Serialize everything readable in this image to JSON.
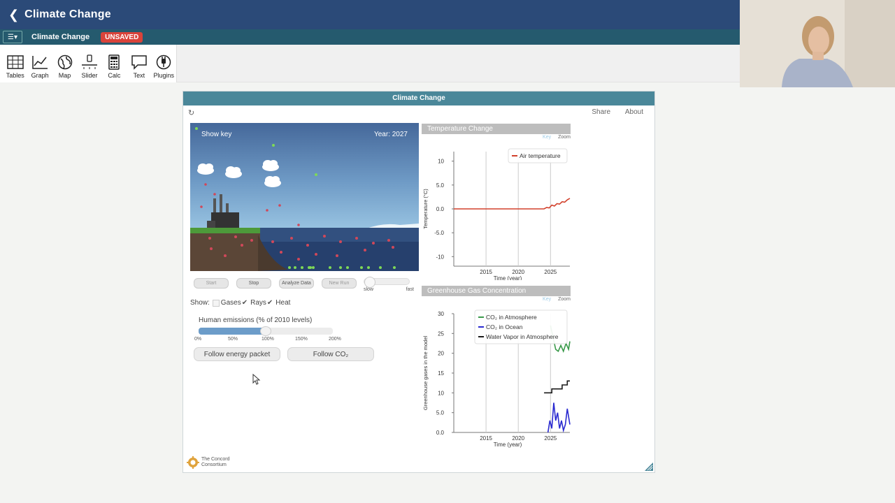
{
  "app": {
    "title": "Climate Change",
    "back_icon": "chevron-left-icon"
  },
  "docbar": {
    "doc_name": "Climate Change",
    "status": "UNSAVED"
  },
  "toolbar": {
    "tools": [
      {
        "label": "Tables",
        "icon": "table-icon"
      },
      {
        "label": "Graph",
        "icon": "graph-icon"
      },
      {
        "label": "Map",
        "icon": "globe-icon"
      },
      {
        "label": "Slider",
        "icon": "slider-icon"
      },
      {
        "label": "Calc",
        "icon": "calculator-icon"
      },
      {
        "label": "Text",
        "icon": "speech-bubble-icon"
      },
      {
        "label": "Plugins",
        "icon": "plug-icon"
      }
    ]
  },
  "tile": {
    "title": "Climate Change",
    "share": "Share",
    "about": "About"
  },
  "sim": {
    "show_key": "Show key",
    "year": "Year: 2027",
    "buttons": {
      "start": "Start",
      "stop": "Stop",
      "analyze": "Analyze Data",
      "new_run": "New Run"
    },
    "speed": {
      "slow": "slow",
      "fast": "fast",
      "level": 0
    },
    "show": {
      "label": "Show:",
      "gases": "Gases",
      "rays": "Rays",
      "heat": "Heat",
      "gases_checked": true,
      "rays_checked": true
    },
    "emissions": {
      "label": "Human emissions (% of 2010 levels)",
      "value_percent": 100,
      "ticks": [
        "0%",
        "50%",
        "100%",
        "150%",
        "200%"
      ]
    },
    "follow_energy": "Follow energy packet",
    "follow_co2": "Follow CO₂"
  },
  "chart_data": [
    {
      "type": "line",
      "title": "Temperature Change",
      "key_label": "Key",
      "zoom_label": "Zoom",
      "xlabel": "Time (year)",
      "ylabel": "Temperature (°C)",
      "xlim": [
        2010,
        2028
      ],
      "ylim": [
        -12,
        12
      ],
      "xticks": [
        "2015",
        "2020",
        "2025"
      ],
      "yticks": [
        "10",
        "5.0",
        "0.0",
        "-5.0",
        "-10"
      ],
      "legend": "top-right",
      "series": [
        {
          "name": "Air temperature",
          "color": "#d2402b",
          "x": [
            2010,
            2024.0,
            2024.4,
            2024.8,
            2025.2,
            2025.6,
            2026.0,
            2026.4,
            2026.8,
            2027.2,
            2027.6,
            2028
          ],
          "y": [
            0,
            0,
            0.3,
            0.2,
            0.8,
            0.6,
            1.1,
            1.0,
            1.5,
            1.4,
            1.9,
            2.2
          ]
        }
      ]
    },
    {
      "type": "line",
      "title": "Greenhouse Gas Concentration",
      "key_label": "Key",
      "zoom_label": "Zoom",
      "xlabel": "Time (year)",
      "ylabel": "Greenhouse gases in the model",
      "xlim": [
        2010,
        2028
      ],
      "ylim": [
        0,
        30
      ],
      "xticks": [
        "2015",
        "2020",
        "2025"
      ],
      "yticks": [
        "30",
        "25",
        "20",
        "15",
        "10",
        "5.0",
        "0.0"
      ],
      "legend": "top-right",
      "series": [
        {
          "name": "CO₂ in Atmosphere",
          "color": "#3a9a4a",
          "x": [
            2025.0,
            2025.4,
            2025.8,
            2026.2,
            2026.6,
            2027.0,
            2027.4,
            2027.8,
            2028
          ],
          "y": [
            27,
            24,
            21,
            20.5,
            22,
            20.5,
            22.5,
            21,
            23
          ]
        },
        {
          "name": "CO₂ in Ocean",
          "color": "#2a2ad0",
          "x": [
            2024.6,
            2024.9,
            2025.2,
            2025.5,
            2025.8,
            2026.1,
            2026.4,
            2026.7,
            2027.0,
            2027.3,
            2027.6,
            2028
          ],
          "y": [
            0,
            3,
            1,
            7.5,
            3,
            5,
            1,
            3,
            0.5,
            2,
            6,
            2
          ]
        },
        {
          "name": "Water Vapor in Atmosphere",
          "color": "#1a1a1a",
          "x": [
            2024.0,
            2025.2,
            2025.2,
            2026.8,
            2026.8,
            2027.6,
            2027.6,
            2028
          ],
          "y": [
            10,
            10,
            11,
            11,
            12,
            12,
            13,
            13
          ]
        }
      ]
    }
  ],
  "footer": {
    "line1": "The Concord",
    "line2": "Consortium"
  }
}
